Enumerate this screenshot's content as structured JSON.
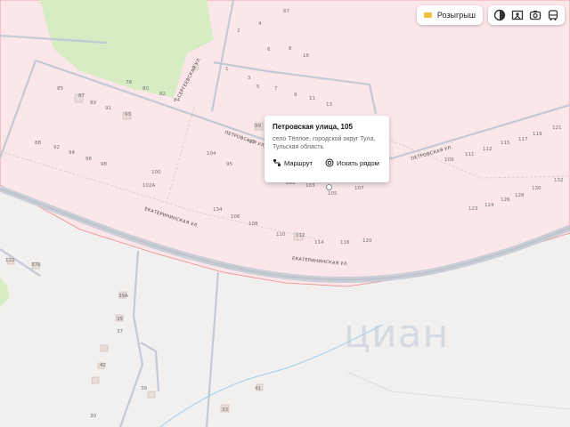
{
  "toolbar": {
    "promo_label": "Розыгрыш",
    "icons": [
      "layers-icon",
      "panorama-icon",
      "camera-icon",
      "transport-icon"
    ]
  },
  "popup": {
    "title": "Петровская улица, 105",
    "subtitle": "село Тёплое, городской округ Тула, Тульская область",
    "route_label": "Маршрут",
    "nearby_label": "Искать рядом"
  },
  "streets": {
    "petrovskaya_left": "ПЕТРОВСКАЯ УЛ.",
    "petrovskaya_right": "ПЕТРОВСКАЯ УЛ.",
    "sergeevskaya": "СЕРГЕЕВСКАЯ УЛ.",
    "ekaterininskaya_1": "ЕКАТЕРИНИНСКАЯ УЛ.",
    "ekaterininskaya_2": "ЕКАТЕРИНИНСКАЯ УЛ."
  },
  "house_numbers": [
    "67",
    "2",
    "4",
    "6",
    "8",
    "16",
    "1",
    "3",
    "5",
    "7",
    "9",
    "11",
    "13",
    "78",
    "80",
    "85",
    "87",
    "89",
    "91",
    "93",
    "82",
    "84",
    "88",
    "92",
    "94",
    "96",
    "98",
    "100",
    "102А",
    "104",
    "95",
    "97",
    "99",
    "101",
    "103",
    "105",
    "107",
    "109",
    "111",
    "112",
    "115",
    "117",
    "119",
    "121",
    "123",
    "124",
    "126",
    "128",
    "130",
    "132",
    "134",
    "106",
    "108",
    "110",
    "112",
    "114",
    "116",
    "120",
    "122",
    "37Б",
    "39А",
    "35",
    "37",
    "39",
    "41",
    "42",
    "30",
    "33",
    "67"
  ],
  "watermark": "циан"
}
